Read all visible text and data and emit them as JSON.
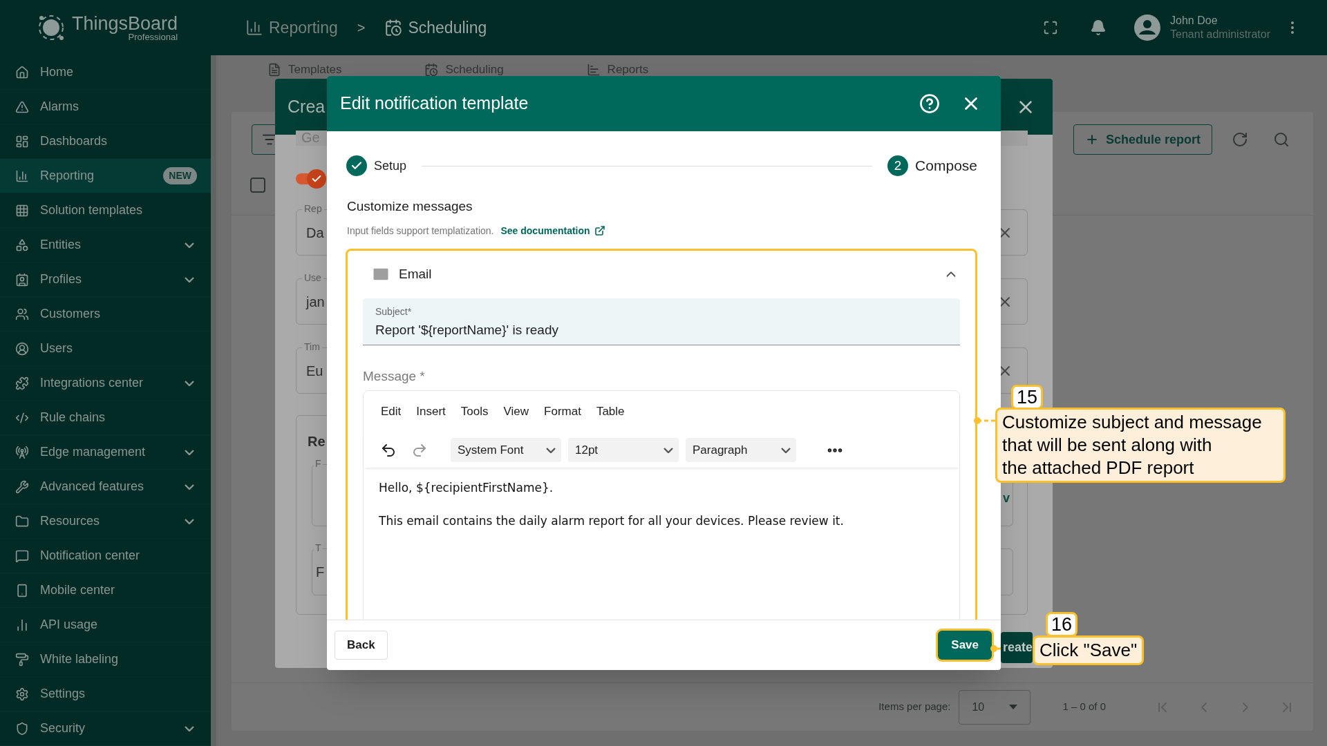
{
  "header": {
    "logo_title": "ThingsBoard",
    "logo_subtitle": "Professional",
    "breadcrumbs": [
      {
        "label": "Reporting"
      },
      {
        "label": "Scheduling"
      }
    ],
    "separator": ">",
    "user": {
      "name": "John Doe",
      "role": "Tenant administrator"
    }
  },
  "sidebar": {
    "items": [
      {
        "label": "Home",
        "selected": false,
        "expandable": false
      },
      {
        "label": "Alarms",
        "selected": false,
        "expandable": false
      },
      {
        "label": "Dashboards",
        "selected": false,
        "expandable": false
      },
      {
        "label": "Reporting",
        "selected": true,
        "expandable": false,
        "badge": "NEW"
      },
      {
        "label": "Solution templates",
        "selected": false,
        "expandable": false
      },
      {
        "label": "Entities",
        "selected": false,
        "expandable": true
      },
      {
        "label": "Profiles",
        "selected": false,
        "expandable": true
      },
      {
        "label": "Customers",
        "selected": false,
        "expandable": false
      },
      {
        "label": "Users",
        "selected": false,
        "expandable": false
      },
      {
        "label": "Integrations center",
        "selected": false,
        "expandable": true
      },
      {
        "label": "Rule chains",
        "selected": false,
        "expandable": false
      },
      {
        "label": "Edge management",
        "selected": false,
        "expandable": true
      },
      {
        "label": "Advanced features",
        "selected": false,
        "expandable": true
      },
      {
        "label": "Resources",
        "selected": false,
        "expandable": true
      },
      {
        "label": "Notification center",
        "selected": false,
        "expandable": false
      },
      {
        "label": "Mobile center",
        "selected": false,
        "expandable": false
      },
      {
        "label": "API usage",
        "selected": false,
        "expandable": false
      },
      {
        "label": "White labeling",
        "selected": false,
        "expandable": false
      },
      {
        "label": "Settings",
        "selected": false,
        "expandable": false
      },
      {
        "label": "Security",
        "selected": false,
        "expandable": true
      }
    ]
  },
  "page": {
    "tabs": [
      {
        "label": "Templates"
      },
      {
        "label": "Scheduling"
      },
      {
        "label": "Reports"
      }
    ],
    "schedule_button": "Schedule report",
    "select_all_checked": false,
    "pagination": {
      "label": "Items per page:",
      "page_size": "10",
      "range": "1 – 0 of 0"
    }
  },
  "background_dialog": {
    "title": "Crea",
    "search_fragment": "Ge",
    "toggle_on": true,
    "fields": [
      {
        "label": "Rep",
        "value": "Da"
      },
      {
        "label": "Use",
        "value": "jan"
      },
      {
        "label": "Tim",
        "value": "Eu"
      }
    ],
    "section": {
      "title": "Re",
      "link_fragment": "v",
      "fields": [
        {
          "label": "F"
        },
        {
          "label": "T",
          "value": "F"
        }
      ]
    },
    "button_fragment": "reate"
  },
  "dialog": {
    "title": "Edit notification template",
    "steps": [
      {
        "label": "Setup",
        "done": true
      },
      {
        "number": "2",
        "label": "Compose",
        "done": false
      }
    ],
    "heading": "Customize messages",
    "hint": "Input fields support templatization.",
    "link": "See documentation",
    "section": {
      "title": "Email",
      "expanded": true,
      "highlighted": true,
      "subject": {
        "label": "Subject*",
        "value": "Report '${reportName}' is ready"
      },
      "message_label": "Message *",
      "menu": [
        "Edit",
        "Insert",
        "Tools",
        "View",
        "Format",
        "Table"
      ],
      "font": "System Font",
      "size": "12pt",
      "block": "Paragraph",
      "body": [
        "Hello, ${recipientFirstName}.",
        "This email contains the daily alarm report for all your devices. Please review it."
      ]
    },
    "back_button": "Back",
    "save_button": {
      "label": "Save",
      "highlighted": true
    }
  },
  "callouts": [
    {
      "number": "15",
      "text": "Customize subject and message\nthat will be sent along with\nthe attached PDF report"
    },
    {
      "number": "16",
      "text": "Click \"Save\""
    }
  ]
}
